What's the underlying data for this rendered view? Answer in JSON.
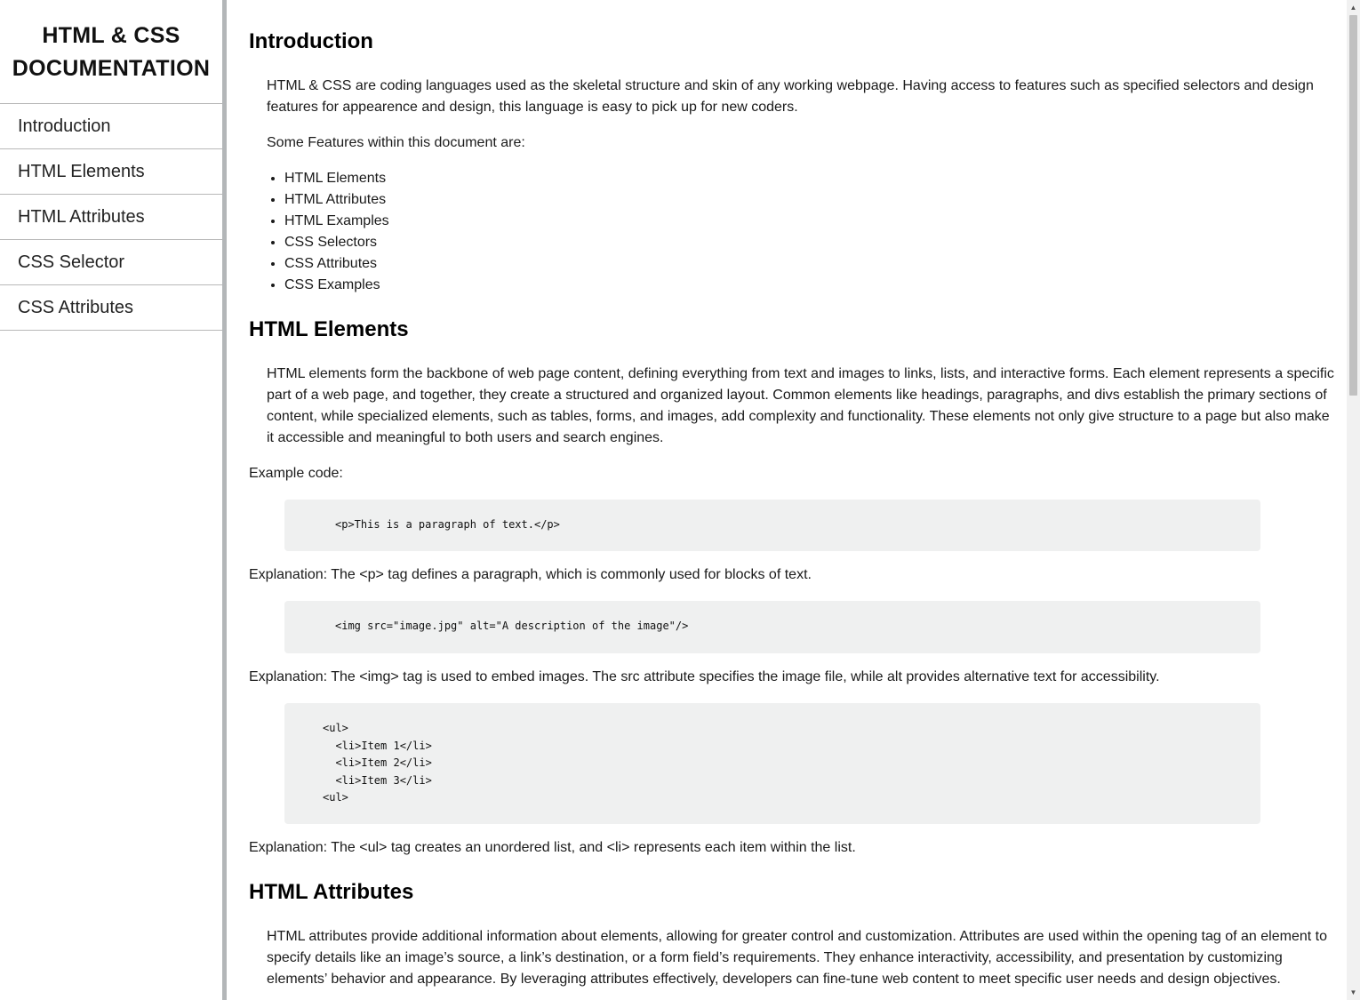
{
  "nav": {
    "title_line1": "HTML & CSS",
    "title_line2": "DOCUMENTATION",
    "links": [
      "Introduction",
      "HTML Elements",
      "HTML Attributes",
      "CSS Selector",
      "CSS Attributes"
    ]
  },
  "sections": {
    "intro": {
      "title": "Introduction",
      "para1": "HTML & CSS are coding languages used as the skeletal structure and skin of any working webpage. Having access to features such as specified selectors and design features for appearence and design, this language is easy to pick up for new coders.",
      "para2": "Some Features within this document are:",
      "features": [
        "HTML Elements",
        "HTML Attributes",
        "HTML Examples",
        "CSS Selectors",
        "CSS Attributes",
        "CSS Examples"
      ]
    },
    "elements": {
      "title": "HTML Elements",
      "para1": "HTML elements form the backbone of web page content, defining everything from text and images to links, lists, and interactive forms. Each element represents a specific part of a web page, and together, they create a structured and organized layout. Common elements like headings, paragraphs, and divs establish the primary sections of content, while specialized elements, such as tables, forms, and images, add complexity and functionality. These elements not only give structure to a page but also make it accessible and meaningful to both users and search engines.",
      "example_label": "Example code:",
      "code1": "<p>This is a paragraph of text.</p>",
      "explain1": "Explanation: The <p> tag defines a paragraph, which is commonly used for blocks of text.",
      "code2": "<img src=\"image.jpg\" alt=\"A description of the image\"/>",
      "explain2": "Explanation: The <img> tag is used to embed images. The src attribute specifies the image file, while alt provides alternative text for accessibility.",
      "code3": "<ul>\n  <li>Item 1</li>\n  <li>Item 2</li>\n  <li>Item 3</li>\n<ul>",
      "explain3": "Explanation: The <ul> tag creates an unordered list, and <li> represents each item within the list."
    },
    "attributes": {
      "title": "HTML Attributes",
      "para1": "HTML attributes provide additional information about elements, allowing for greater control and customization. Attributes are used within the opening tag of an element to specify details like an image’s source, a link’s destination, or a form field’s requirements. They enhance interactivity, accessibility, and presentation by customizing elements’ behavior and appearance. By leveraging attributes effectively, developers can fine-tune web content to meet specific user needs and design objectives."
    }
  }
}
